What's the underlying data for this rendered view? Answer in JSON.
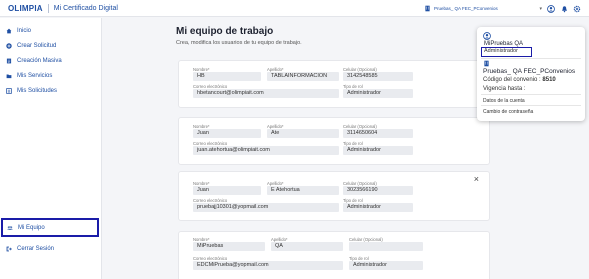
{
  "header": {
    "logo": "OLIMPIA",
    "app_title": "Mi Certificado Digital",
    "selector_value": "Pruebas_ QA FEC_PConvenios"
  },
  "sidebar": {
    "items": [
      {
        "label": "Inicio",
        "icon": "home-icon"
      },
      {
        "label": "Crear Solicitud",
        "icon": "add-circle-icon"
      },
      {
        "label": "Creación Masiva",
        "icon": "document-icon"
      },
      {
        "label": "Mis Servicios",
        "icon": "folder-icon"
      },
      {
        "label": "Mis Solicitudes",
        "icon": "list-icon"
      }
    ],
    "active_item": {
      "label": "Mi Equipo",
      "icon": "team-icon"
    },
    "logout_label": "Cerrar Sesión"
  },
  "main": {
    "title": "Mi equipo de trabajo",
    "subtitle": "Crea, modifica los usuarios de tu equipo de trabajo.",
    "members": [
      {
        "labels": {
          "nombre": "Nombre*",
          "apellido": "Apellido*",
          "celular": "Celular (Opcional)",
          "correo": "Correo electrónico",
          "rol": "Tipo de rol"
        },
        "nombre": "HB",
        "apellido": "TABLAINFORMACION",
        "celular": "3142548585",
        "correo": "hbetancourt@olimpiait.com",
        "rol": "Administrador"
      },
      {
        "labels": {
          "nombre": "Nombre*",
          "apellido": "Apellido*",
          "celular": "Celular (Opcional)",
          "correo": "Correo electrónico",
          "rol": "Tipo de rol"
        },
        "nombre": "Juan",
        "apellido": "Ate",
        "celular": "3114650604",
        "correo": "juan.atehortua@olimpiait.com",
        "rol": "Administrador"
      },
      {
        "labels": {
          "nombre": "Nombre*",
          "apellido": "Apellido*",
          "celular": "Celular (Opcional)",
          "correo": "Correo electrónico",
          "rol": "Tipo de rol"
        },
        "nombre": "Juan",
        "apellido": "E Atehortua",
        "celular": "3023566190",
        "correo": "pruebajj10301@yopmail.com",
        "rol": "Administrador",
        "close_label": "×"
      },
      {
        "labels": {
          "nombre": "Nombre*",
          "apellido": "Apellido*",
          "celular": "Celular (Opcional)",
          "correo": "Correo electrónico",
          "rol": "Tipo de rol"
        },
        "nombre": "MiPruebas",
        "apellido": "QA",
        "celular": "",
        "correo": "EDCMiPrueba@yopmail.com",
        "rol": "Administrador"
      }
    ]
  },
  "popup": {
    "user_name": "MiPruebas QA",
    "role": "Administrador",
    "company": "Pruebas_ QA FEC_PConvenios",
    "code_label": "Código del convenio :",
    "code_value": "8510",
    "validity_label": "Vigencia hasta :",
    "link_account": "Datos de la cuenta",
    "link_password": "Cambio de contraseña"
  },
  "colors": {
    "brand": "#1f4fa3",
    "highlight_border": "#1a1ca8",
    "field_bg": "#e9ebef"
  }
}
